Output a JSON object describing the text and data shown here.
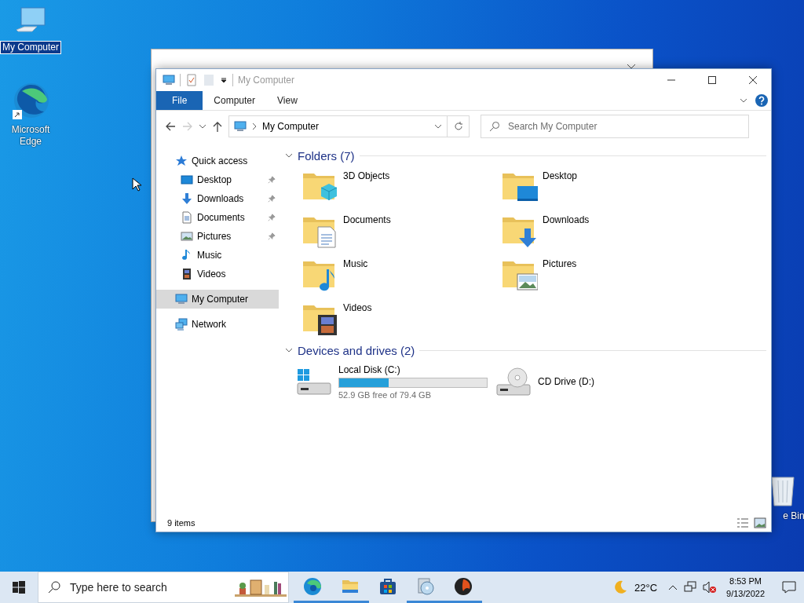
{
  "desktop_icons": [
    {
      "kind": "computer",
      "label": "My Computer",
      "selected": true
    },
    {
      "kind": "edge",
      "label": "Microsoft Edge",
      "selected": false
    },
    {
      "kind": "bin",
      "label": "e Bin",
      "selected": false
    }
  ],
  "window": {
    "title": "My Computer",
    "ribbon_tabs": [
      {
        "label": "File",
        "selected": true
      },
      {
        "label": "Computer",
        "selected": false
      },
      {
        "label": "View",
        "selected": false
      }
    ],
    "address": "My Computer",
    "search": {
      "placeholder": "Search My Computer"
    },
    "nav": [
      {
        "kind": "quick",
        "label": "Quick access",
        "selected": false,
        "children": [
          {
            "kind": "desktop",
            "label": "Desktop",
            "pinned": true
          },
          {
            "kind": "downloads",
            "label": "Downloads",
            "pinned": true
          },
          {
            "kind": "documents",
            "label": "Documents",
            "pinned": true
          },
          {
            "kind": "pictures",
            "label": "Pictures",
            "pinned": true
          },
          {
            "kind": "music",
            "label": "Music",
            "pinned": false
          },
          {
            "kind": "videos",
            "label": "Videos",
            "pinned": false
          }
        ]
      },
      {
        "kind": "computer",
        "label": "My Computer",
        "selected": true
      },
      {
        "kind": "network",
        "label": "Network",
        "selected": false
      }
    ],
    "sections": [
      {
        "title": "Folders (7)",
        "expanded": true,
        "items": [
          {
            "kind": "cube",
            "label": "3D Objects"
          },
          {
            "kind": "desktop",
            "label": "Desktop"
          },
          {
            "kind": "documents",
            "label": "Documents"
          },
          {
            "kind": "downloads",
            "label": "Downloads"
          },
          {
            "kind": "music",
            "label": "Music"
          },
          {
            "kind": "pictures",
            "label": "Pictures"
          },
          {
            "kind": "videos",
            "label": "Videos"
          }
        ]
      },
      {
        "title": "Devices and drives (2)",
        "expanded": true,
        "items": [
          {
            "kind": "disk",
            "label": "Local Disk (C:)",
            "level": 0.334,
            "detail": "52.9 GB free of 79.4 GB"
          },
          {
            "kind": "cd",
            "label": "CD Drive (D:)"
          }
        ]
      }
    ],
    "status": "9 items"
  },
  "taskbar": {
    "search_placeholder": "Type here to search",
    "apps": [
      {
        "kind": "edge",
        "running": true
      },
      {
        "kind": "explorer",
        "running": true
      },
      {
        "kind": "store",
        "running": false
      },
      {
        "kind": "disc",
        "running": true
      },
      {
        "kind": "orb",
        "running": true
      }
    ],
    "temperature": "22°C",
    "time": "8:53 PM",
    "date": "9/13/2022"
  }
}
